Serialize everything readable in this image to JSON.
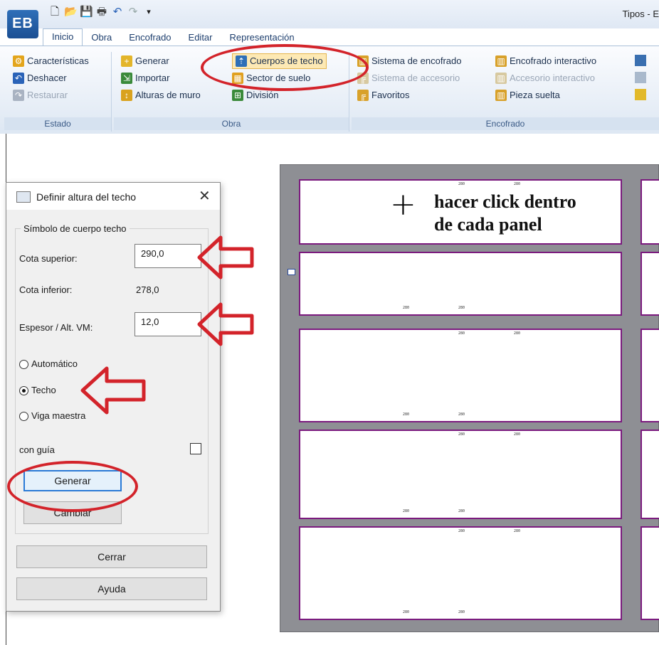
{
  "window": {
    "title": "Tipos - E"
  },
  "app_button_label": "EB",
  "quick_access": [
    "new-icon",
    "open-icon",
    "save-icon",
    "print-icon",
    "undo-icon",
    "redo-icon",
    "customize-icon"
  ],
  "tabs": [
    "Inicio",
    "Obra",
    "Encofrado",
    "Editar",
    "Representación"
  ],
  "ribbon": {
    "estado": {
      "label": "Estado",
      "items": [
        "Características",
        "Deshacer",
        "Restaurar"
      ]
    },
    "obra": {
      "label": "Obra",
      "items_a": [
        "Generar",
        "Importar",
        "Alturas de muro"
      ],
      "items_b": [
        "Cuerpos de techo",
        "Sector de suelo",
        "División"
      ]
    },
    "encofrado": {
      "label": "Encofrado",
      "items_a": [
        "Sistema de encofrado",
        "Sistema de accesorio",
        "Favoritos"
      ],
      "items_b": [
        "Encofrado interactivo",
        "Accesorio interactivo",
        "Pieza suelta"
      ]
    }
  },
  "dialog": {
    "title": "Definir altura del techo",
    "group_label": "Símbolo de cuerpo techo",
    "cota_superior_label": "Cota superior:",
    "cota_superior_value": "290,0",
    "cota_inferior_label": "Cota inferior:",
    "cota_inferior_value": "278,0",
    "espesor_label": "Espesor / Alt. VM:",
    "espesor_value": "12,0",
    "radio_automatico": "Automático",
    "radio_techo": "Techo",
    "radio_viga": "Viga maestra",
    "con_guia_label": "con guía",
    "generar": "Generar",
    "cambiar": "Cambiar",
    "cerrar": "Cerrar",
    "ayuda": "Ayuda"
  },
  "annotation": {
    "text": "hacer click dentro de cada panel",
    "cross": "+"
  },
  "panel_dim": "280",
  "colors": {
    "annotation_red": "#d3232a",
    "panel_border": "#7b1a7e",
    "plan_bg": "#8e8f94"
  }
}
